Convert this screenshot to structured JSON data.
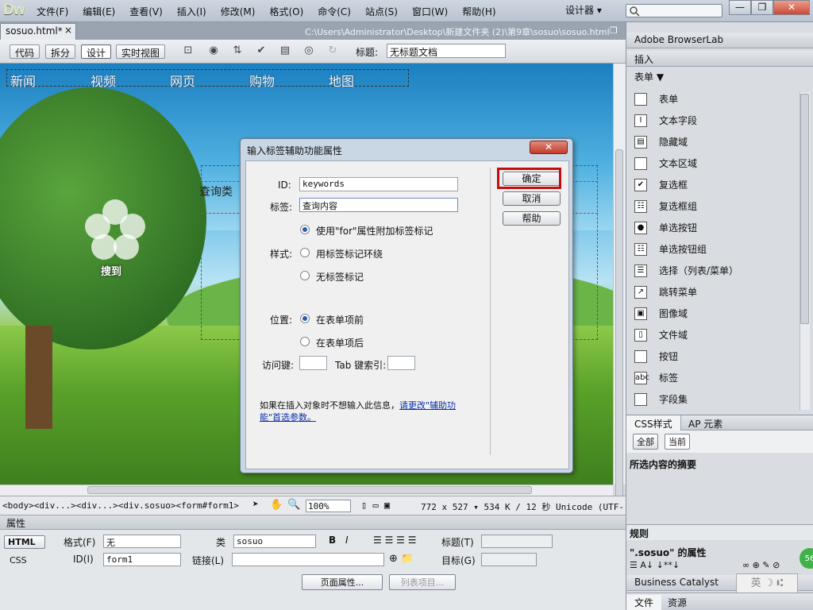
{
  "app": {
    "logo": "Dw",
    "workspace": "设计器 ▾"
  },
  "menu": [
    "文件(F)",
    "编辑(E)",
    "查看(V)",
    "插入(I)",
    "修改(M)",
    "格式(O)",
    "命令(C)",
    "站点(S)",
    "窗口(W)",
    "帮助(H)"
  ],
  "window_controls": {
    "minimize": "—",
    "restore": "❐",
    "close": "✕"
  },
  "document": {
    "tab": "sosuo.html*",
    "tab_close": "×",
    "path": "C:\\Users\\Administrator\\Desktop\\新建文件夹 (2)\\第9章\\sosuo\\sosuo.html"
  },
  "doc_toolbar": {
    "views": [
      "代码",
      "拆分",
      "设计",
      "实时视图"
    ],
    "active_view": "设计",
    "title_label": "标题:",
    "title_value": "无标题文档"
  },
  "canvas": {
    "nav": [
      "新闻",
      "视频",
      "网页",
      "购物",
      "地图"
    ],
    "logo_text": "搜到",
    "query_text": "查询类"
  },
  "statusbar": {
    "tag_path": "<body><div...><div...><div.sosuo><form#form1>",
    "zoom": "100%",
    "dims": "772 x 527 ▾ 534 K / 12 秒 Unicode (UTF-8)"
  },
  "properties": {
    "header": "属性",
    "html_btn": "HTML",
    "css_btn": "CSS",
    "format_label": "格式(F)",
    "format_value": "无",
    "class_label": "类",
    "class_value": "sosuo",
    "title_label": "标题(T)",
    "id_label": "ID(I)",
    "id_value": "form1",
    "link_label": "链接(L)",
    "target_label": "目标(G)",
    "page_props_btn": "页面属性...",
    "list_items_btn": "列表项目..."
  },
  "right_panel": {
    "browserlab": "Adobe BrowserLab",
    "insert_tab": "插入",
    "category": "表单 ▼",
    "items": [
      {
        "icon": "form-icon",
        "label": "表单"
      },
      {
        "icon": "textfield-icon",
        "label": "文本字段"
      },
      {
        "icon": "hidden-field-icon",
        "label": "隐藏域"
      },
      {
        "icon": "textarea-icon",
        "label": "文本区域"
      },
      {
        "icon": "checkbox-icon",
        "label": "复选框"
      },
      {
        "icon": "checkbox-group-icon",
        "label": "复选框组"
      },
      {
        "icon": "radio-icon",
        "label": "单选按钮"
      },
      {
        "icon": "radio-group-icon",
        "label": "单选按钮组"
      },
      {
        "icon": "select-icon",
        "label": "选择（列表/菜单）"
      },
      {
        "icon": "jump-menu-icon",
        "label": "跳转菜单"
      },
      {
        "icon": "image-field-icon",
        "label": "图像域"
      },
      {
        "icon": "file-field-icon",
        "label": "文件域"
      },
      {
        "icon": "button-icon",
        "label": "按钮"
      },
      {
        "icon": "label-icon",
        "label": "标签"
      },
      {
        "icon": "fieldset-icon",
        "label": "字段集"
      }
    ],
    "css_tabs": [
      "CSS样式",
      "AP 元素"
    ],
    "css_modes": [
      "全部",
      "当前"
    ],
    "summary_title": "所选内容的摘要",
    "rules_title": "规则",
    "props_title": "\".sosuo\" 的属性",
    "business_catalyst": "Business Catalyst",
    "bottom_tabs": [
      "文件",
      "资源"
    ],
    "badge": "56",
    "ime": "英 ☽ ⑆"
  },
  "dialog": {
    "title": "输入标签辅助功能属性",
    "id_label": "ID:",
    "id_value": "keywords",
    "label_label": "标签:",
    "label_value": "查询内容",
    "style_label": "样式:",
    "style_options": [
      "使用\"for\"属性附加标签标记",
      "用标签标记环绕",
      "无标签标记"
    ],
    "style_selected": 0,
    "position_label": "位置:",
    "position_options": [
      "在表单项前",
      "在表单项后"
    ],
    "position_selected": 0,
    "access_key_label": "访问键:",
    "tab_index_label": "Tab 键索引:",
    "note_text": "如果在插入对象时不想输入此信息，",
    "note_link": "请更改\"辅助功能\"首选参数。",
    "ok": "确定",
    "cancel": "取消",
    "help": "帮助"
  }
}
